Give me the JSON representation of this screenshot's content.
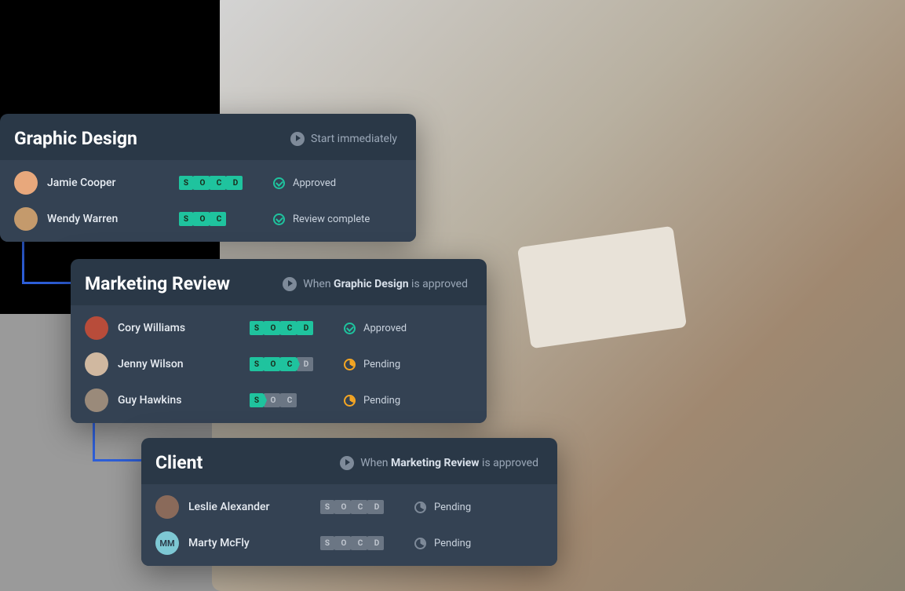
{
  "cards": [
    {
      "title": "Graphic Design",
      "trigger_prefix": "",
      "trigger_bold": "",
      "trigger_suffix": "Start immediately",
      "rows": [
        {
          "name": "Jamie Cooper",
          "avatar_bg": "#e8a87c",
          "stages": [
            {
              "l": "S",
              "on": true
            },
            {
              "l": "O",
              "on": true
            },
            {
              "l": "C",
              "on": true
            },
            {
              "l": "D",
              "on": true
            }
          ],
          "status": "Approved",
          "status_icon": "check"
        },
        {
          "name": "Wendy Warren",
          "avatar_bg": "#c49a6c",
          "stages": [
            {
              "l": "S",
              "on": true
            },
            {
              "l": "O",
              "on": true
            },
            {
              "l": "C",
              "on": true
            }
          ],
          "status": "Review complete",
          "status_icon": "check"
        }
      ]
    },
    {
      "title": "Marketing Review",
      "trigger_prefix": "When ",
      "trigger_bold": "Graphic Design",
      "trigger_suffix": " is approved",
      "rows": [
        {
          "name": "Cory Williams",
          "avatar_bg": "#b84c3a",
          "stages": [
            {
              "l": "S",
              "on": true
            },
            {
              "l": "O",
              "on": true
            },
            {
              "l": "C",
              "on": true
            },
            {
              "l": "D",
              "on": true
            }
          ],
          "status": "Approved",
          "status_icon": "check"
        },
        {
          "name": "Jenny Wilson",
          "avatar_bg": "#d0b8a0",
          "stages": [
            {
              "l": "S",
              "on": true
            },
            {
              "l": "O",
              "on": true
            },
            {
              "l": "C",
              "on": true
            },
            {
              "l": "D",
              "on": false
            }
          ],
          "status": "Pending",
          "status_icon": "pending"
        },
        {
          "name": "Guy Hawkins",
          "avatar_bg": "#9a8a7a",
          "stages": [
            {
              "l": "S",
              "on": true
            },
            {
              "l": "O",
              "on": false
            },
            {
              "l": "C",
              "on": false
            }
          ],
          "status": "Pending",
          "status_icon": "pending"
        }
      ]
    },
    {
      "title": "Client",
      "trigger_prefix": "When ",
      "trigger_bold": "Marketing Review",
      "trigger_suffix": " is approved",
      "rows": [
        {
          "name": "Leslie Alexander",
          "avatar_bg": "#8a6a5a",
          "stages": [
            {
              "l": "S",
              "on": false
            },
            {
              "l": "O",
              "on": false
            },
            {
              "l": "C",
              "on": false
            },
            {
              "l": "D",
              "on": false
            }
          ],
          "status": "Pending",
          "status_icon": "pending-grey"
        },
        {
          "name": "Marty McFly",
          "avatar_bg": "#7ec8d4",
          "avatar_text": "MM",
          "stages": [
            {
              "l": "S",
              "on": false
            },
            {
              "l": "O",
              "on": false
            },
            {
              "l": "C",
              "on": false
            },
            {
              "l": "D",
              "on": false
            }
          ],
          "status": "Pending",
          "status_icon": "pending-grey"
        }
      ]
    }
  ]
}
